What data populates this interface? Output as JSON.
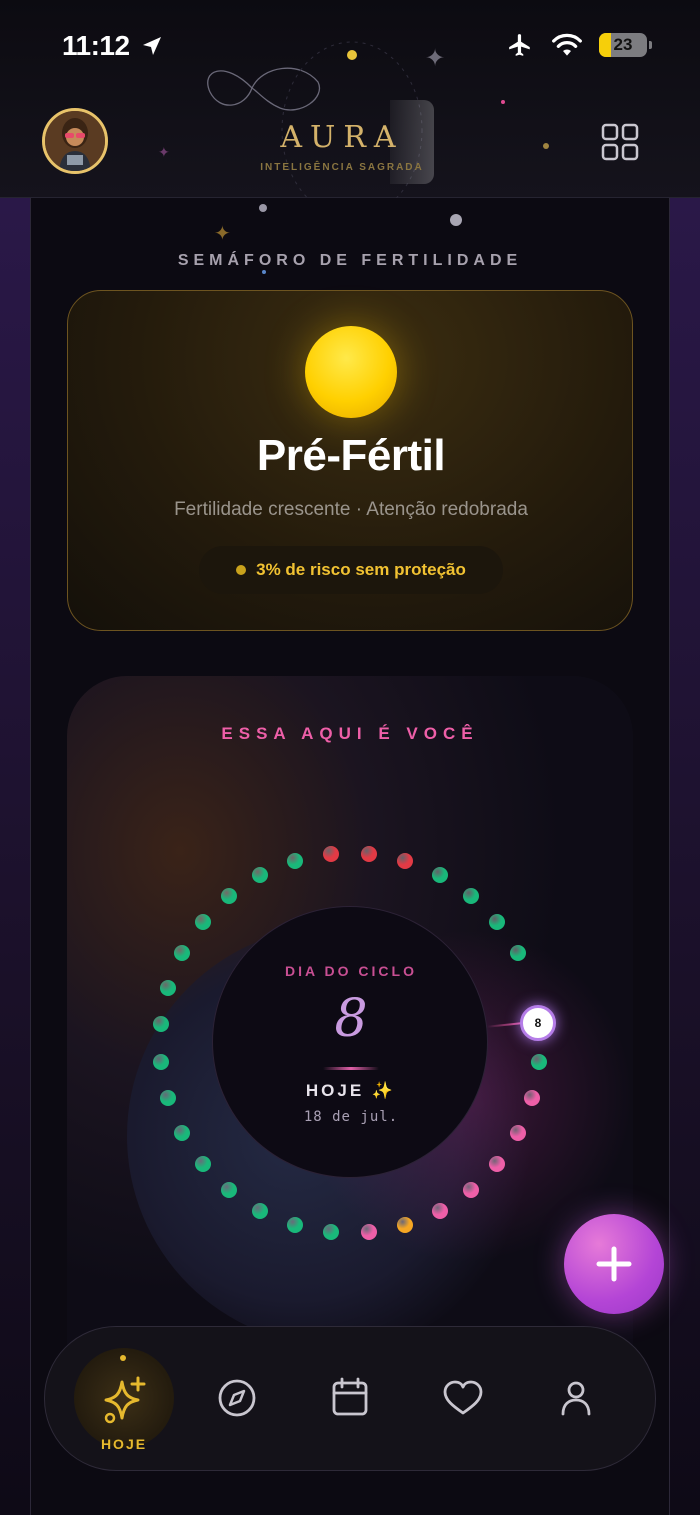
{
  "status_bar": {
    "time": "11:12",
    "battery": "23"
  },
  "header": {
    "brand": "AURA",
    "tagline": "INTELIGÊNCIA SAGRADA",
    "avatar_icon": "user-avatar",
    "menu_icon": "grid-icon"
  },
  "fertility": {
    "section_title": "SEMÁFORO DE FERTILIDADE",
    "status": "Pré-Fértil",
    "description": "Fertilidade crescente · Atenção redobrada",
    "risk": "3% de risco sem proteção",
    "indicator_color": "#ffd000"
  },
  "cycle": {
    "section_title": "ESSA AQUI É VOCÊ",
    "label": "DIA DO CICLO",
    "day": "8",
    "today_label": "HOJE ✨",
    "date": "18 de jul.",
    "marker_day": "8",
    "total_days": 32,
    "colors": {
      "menstrual": "#e23a45",
      "fertile": "#ee5fa8",
      "ovulation": "#f5a623",
      "safe": "#19b87a"
    }
  },
  "fab": {
    "icon": "plus-icon"
  },
  "nav": {
    "items": [
      {
        "id": "hoje",
        "label": "HOJE",
        "icon": "sparkles-icon",
        "active": true
      },
      {
        "id": "explore",
        "label": "",
        "icon": "compass-icon"
      },
      {
        "id": "calendar",
        "label": "",
        "icon": "calendar-icon"
      },
      {
        "id": "favorites",
        "label": "",
        "icon": "heart-icon"
      },
      {
        "id": "profile",
        "label": "",
        "icon": "user-icon"
      }
    ]
  }
}
